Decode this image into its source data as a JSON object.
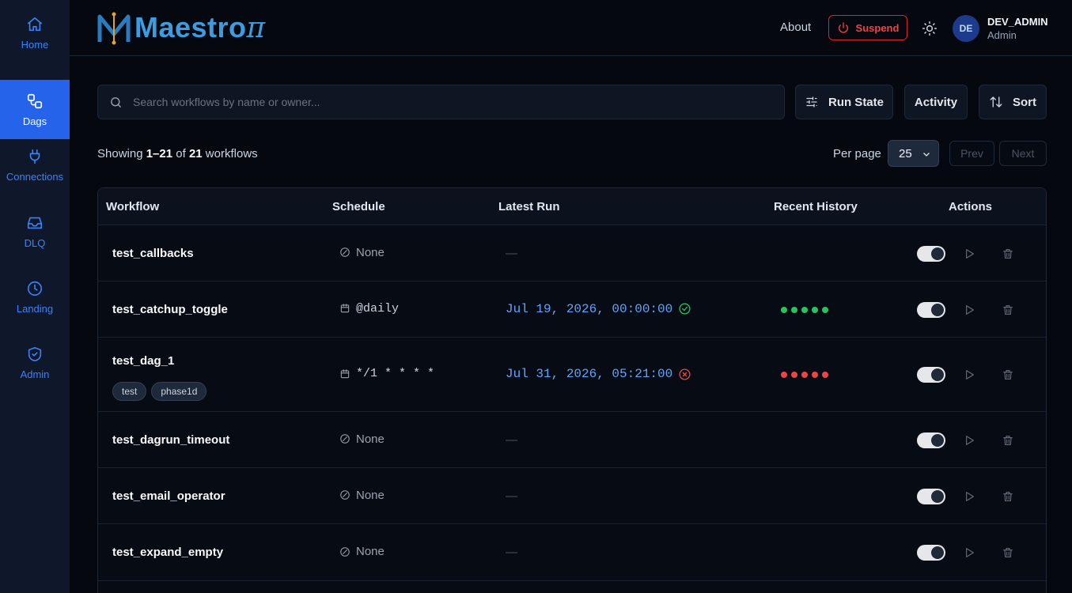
{
  "sidebar": {
    "items": [
      {
        "label": "Home",
        "icon": "home-icon"
      },
      {
        "label": "Dags",
        "icon": "dags-icon",
        "active": true
      },
      {
        "label": "Connections",
        "icon": "plug-icon"
      },
      {
        "label": "DLQ",
        "icon": "inbox-icon"
      },
      {
        "label": "Landing",
        "icon": "clock-icon"
      },
      {
        "label": "Admin",
        "icon": "shield-icon"
      }
    ]
  },
  "header": {
    "logo_text": "Maestro",
    "logo_suffix": "π",
    "about": "About",
    "suspend": "Suspend",
    "user": {
      "initials": "DE",
      "name": "DEV_ADMIN",
      "role": "Admin"
    }
  },
  "toolbar": {
    "search_placeholder": "Search workflows by name or owner...",
    "run_state": "Run State",
    "activity": "Activity",
    "sort": "Sort"
  },
  "pagination": {
    "showing_prefix": "Showing ",
    "range": "1–21",
    "of": " of ",
    "total": "21",
    "suffix": " workflows",
    "per_page_label": "Per page",
    "per_page_value": "25",
    "prev": "Prev",
    "next": "Next"
  },
  "table": {
    "columns": [
      "Workflow",
      "Schedule",
      "Latest Run",
      "Recent History",
      "Actions"
    ],
    "rows": [
      {
        "name": "test_callbacks",
        "tags": [],
        "schedule": "None",
        "schedule_type": "none",
        "latest_run": "",
        "run_status": "",
        "history": []
      },
      {
        "name": "test_catchup_toggle",
        "tags": [],
        "schedule": "@daily",
        "schedule_type": "cron",
        "latest_run": "Jul 19, 2026, 00:00:00",
        "run_status": "success",
        "history": [
          "success",
          "success",
          "success",
          "success",
          "success"
        ]
      },
      {
        "name": "test_dag_1",
        "tags": [
          "test",
          "phase1d"
        ],
        "schedule": "*/1 * * * *",
        "schedule_type": "cron",
        "latest_run": "Jul 31, 2026, 05:21:00",
        "run_status": "failed",
        "history": [
          "failed",
          "failed",
          "failed",
          "failed",
          "failed"
        ]
      },
      {
        "name": "test_dagrun_timeout",
        "tags": [],
        "schedule": "None",
        "schedule_type": "none",
        "latest_run": "",
        "run_status": "",
        "history": []
      },
      {
        "name": "test_email_operator",
        "tags": [],
        "schedule": "None",
        "schedule_type": "none",
        "latest_run": "",
        "run_status": "",
        "history": []
      },
      {
        "name": "test_expand_empty",
        "tags": [],
        "schedule": "None",
        "schedule_type": "none",
        "latest_run": "",
        "run_status": "",
        "history": []
      }
    ],
    "empty_run": "—"
  },
  "colors": {
    "accent": "#2563eb",
    "success": "#22c55e",
    "failed": "#ef4444",
    "run_text": "#60a5fa"
  }
}
